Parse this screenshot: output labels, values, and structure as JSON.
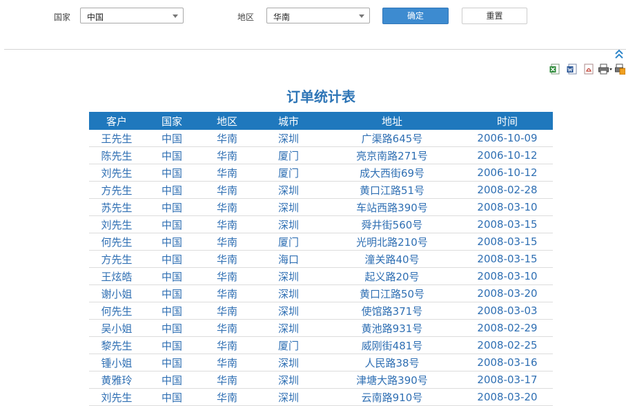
{
  "filters": {
    "country_label": "国家",
    "country_value": "中国",
    "region_label": "地区",
    "region_value": "华南",
    "confirm_label": "确定",
    "reset_label": "重置"
  },
  "toolbar": {
    "icons": [
      "excel-export-icon",
      "word-export-icon",
      "pdf-export-icon",
      "print-icon",
      "print-settings-icon"
    ]
  },
  "report": {
    "title": "订单统计表",
    "columns": [
      "客户",
      "国家",
      "地区",
      "城市",
      "地址",
      "时间"
    ],
    "rows": [
      [
        "王先生",
        "中国",
        "华南",
        "深圳",
        "广渠路645号",
        "2006-10-09"
      ],
      [
        "陈先生",
        "中国",
        "华南",
        "厦门",
        "亮京南路271号",
        "2006-10-12"
      ],
      [
        "刘先生",
        "中国",
        "华南",
        "厦门",
        "成大西街69号",
        "2006-10-12"
      ],
      [
        "方先生",
        "中国",
        "华南",
        "深圳",
        "黄口江路51号",
        "2008-02-28"
      ],
      [
        "苏先生",
        "中国",
        "华南",
        "深圳",
        "车站西路390号",
        "2008-03-10"
      ],
      [
        "刘先生",
        "中国",
        "华南",
        "深圳",
        "舜井街560号",
        "2008-03-15"
      ],
      [
        "何先生",
        "中国",
        "华南",
        "厦门",
        "光明北路210号",
        "2008-03-15"
      ],
      [
        "方先生",
        "中国",
        "华南",
        "海口",
        "潼关路40号",
        "2008-03-15"
      ],
      [
        "王炫皓",
        "中国",
        "华南",
        "深圳",
        "起义路20号",
        "2008-03-10"
      ],
      [
        "谢小姐",
        "中国",
        "华南",
        "深圳",
        "黄口江路50号",
        "2008-03-20"
      ],
      [
        "何先生",
        "中国",
        "华南",
        "深圳",
        "使馆路371号",
        "2008-03-03"
      ],
      [
        "吴小姐",
        "中国",
        "华南",
        "深圳",
        "黄池路931号",
        "2008-02-29"
      ],
      [
        "黎先生",
        "中国",
        "华南",
        "厦门",
        "威刚街481号",
        "2008-02-25"
      ],
      [
        "锺小姐",
        "中国",
        "华南",
        "深圳",
        "人民路38号",
        "2008-03-16"
      ],
      [
        "黄雅玲",
        "中国",
        "华南",
        "深圳",
        "津塘大路390号",
        "2008-03-17"
      ],
      [
        "刘先生",
        "中国",
        "华南",
        "深圳",
        "云南路910号",
        "2008-03-20"
      ]
    ]
  }
}
